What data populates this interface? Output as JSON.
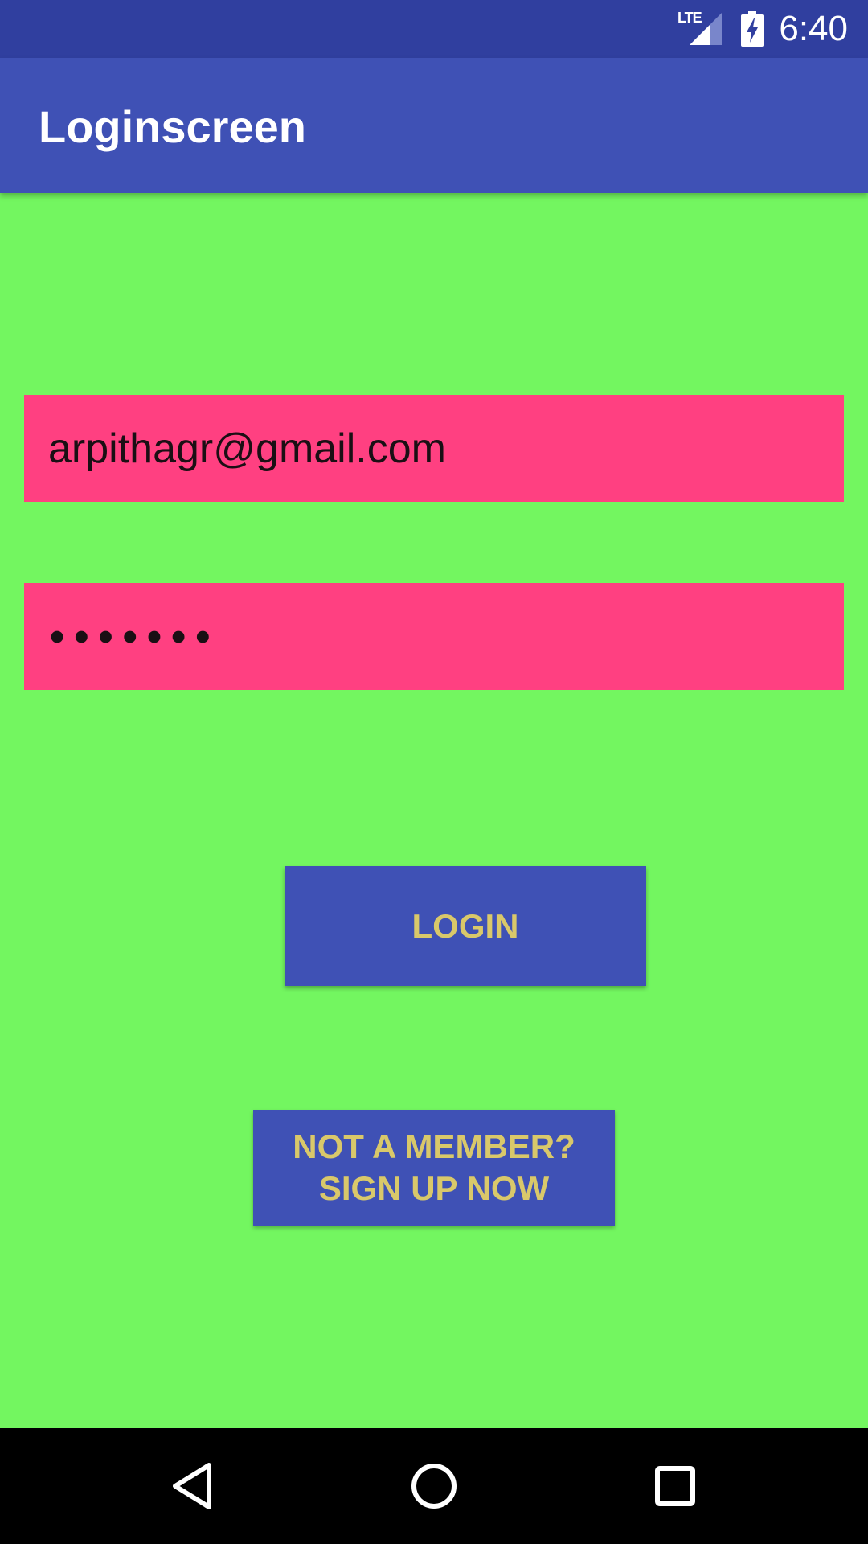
{
  "status_bar": {
    "time": "6:40",
    "network_label": "LTE",
    "icons": [
      "signal-icon",
      "battery-charging-icon"
    ]
  },
  "app_bar": {
    "title": "Loginscreen",
    "color": "#3f51b5"
  },
  "form": {
    "email_value": "arpithagr@gmail.com",
    "password_masked": "•••••••",
    "field_color": "#ff4081"
  },
  "buttons": {
    "login_label": "LOGIN",
    "signup_label": "NOT A MEMBER?\nSIGN UP NOW",
    "button_color": "#3f51b5",
    "text_color": "#d9c86a"
  },
  "nav_bar": {
    "icons": [
      "back-icon",
      "home-icon",
      "recents-icon"
    ]
  },
  "background_color": "#73f660"
}
